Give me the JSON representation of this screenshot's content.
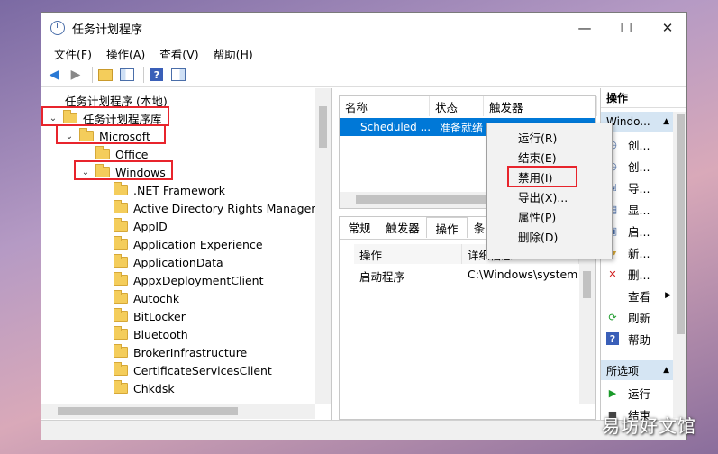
{
  "window": {
    "title": "任务计划程序",
    "controls": [
      "—",
      "☐",
      "✕"
    ]
  },
  "menubar": [
    "文件(F)",
    "操作(A)",
    "查看(V)",
    "帮助(H)"
  ],
  "tree": {
    "root": "任务计划程序 (本地)",
    "library": "任务计划程序库",
    "microsoft": "Microsoft",
    "office": "Office",
    "windows": "Windows",
    "folders": [
      ".NET Framework",
      "Active Directory Rights Manageme",
      "AppID",
      "Application Experience",
      "ApplicationData",
      "AppxDeploymentClient",
      "Autochk",
      "BitLocker",
      "Bluetooth",
      "BrokerInfrastructure",
      "CertificateServicesClient",
      "Chkdsk"
    ]
  },
  "tasklist": {
    "headers": [
      "名称",
      "状态",
      "触发器"
    ],
    "row": {
      "name": "Scheduled ...",
      "status": "准备就绪"
    }
  },
  "details": {
    "tabs": [
      "常规",
      "触发器",
      "操作",
      "条"
    ],
    "headers": [
      "操作",
      "详细信息"
    ],
    "row": {
      "action": "启动程序",
      "detail": "C:\\Windows\\system"
    }
  },
  "context_menu": [
    "运行(R)",
    "结束(E)",
    "禁用(I)",
    "导出(X)...",
    "属性(P)",
    "删除(D)"
  ],
  "actions": {
    "header": "操作",
    "section1": "Windo...",
    "items": [
      "创...",
      "创...",
      "导...",
      "显...",
      "启...",
      "新...",
      "删...",
      "查看",
      "刷新",
      "帮助"
    ],
    "section2": "所选项",
    "sel_items": [
      "运行",
      "结束"
    ]
  },
  "watermark": "易坊好文馆",
  "colors": {
    "highlight": "#cce8ff",
    "selected_row": "#0078d7",
    "red_box": "#e8242c",
    "actions_header": "#d5e5f3"
  }
}
